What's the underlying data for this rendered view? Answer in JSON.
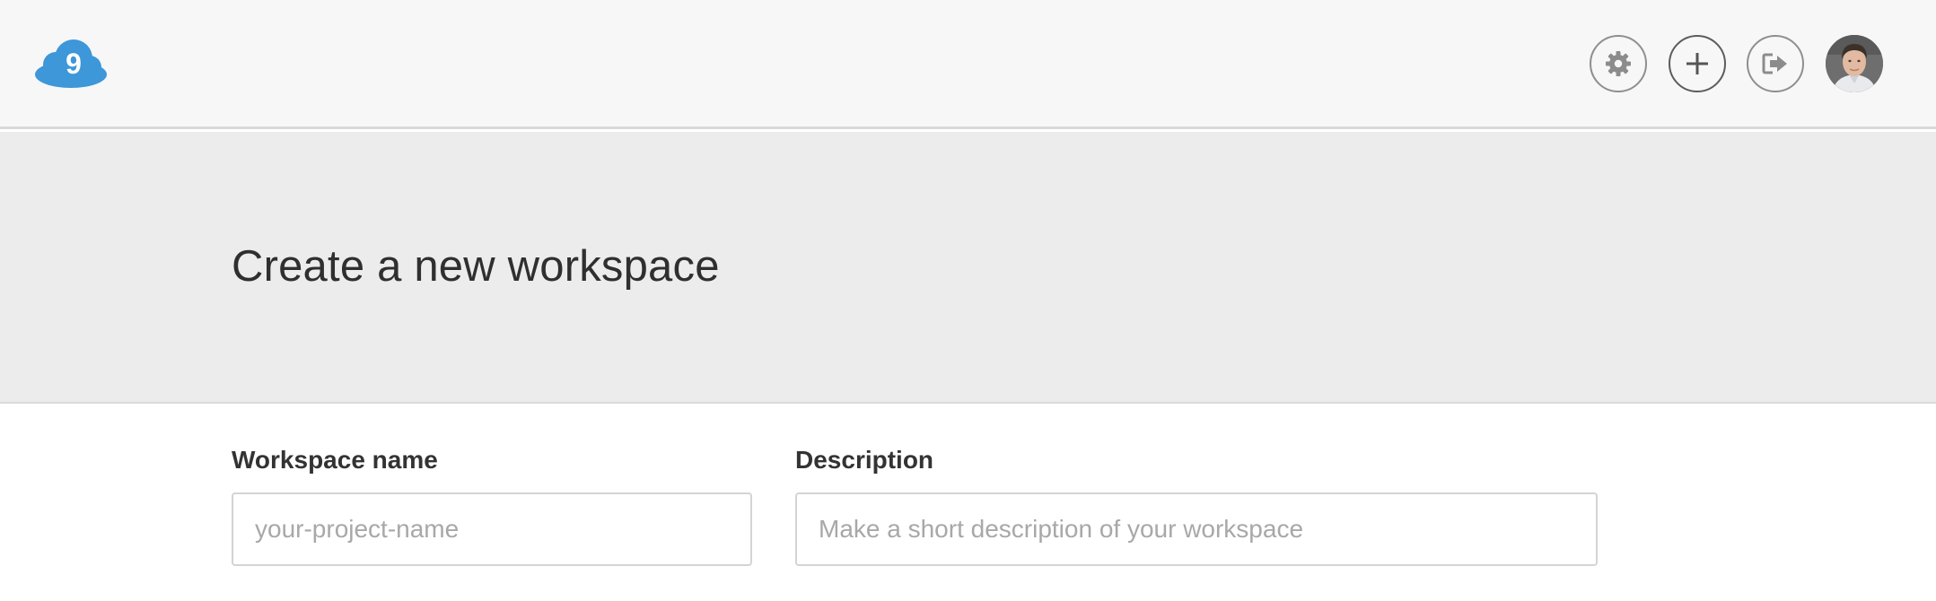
{
  "header": {
    "logo_icon": "cloud9-logo-icon",
    "brand_color": "#3d97d9",
    "buttons": [
      {
        "name": "settings",
        "icon": "gear-icon"
      },
      {
        "name": "create-workspace",
        "icon": "plus-icon"
      },
      {
        "name": "sign-out",
        "icon": "sign-out-icon"
      }
    ],
    "avatar_icon": "user-avatar"
  },
  "hero": {
    "title": "Create a new workspace"
  },
  "form": {
    "workspace_name": {
      "label": "Workspace name",
      "value": "",
      "placeholder": "your-project-name"
    },
    "description": {
      "label": "Description",
      "value": "",
      "placeholder": "Make a short description of your workspace"
    }
  }
}
